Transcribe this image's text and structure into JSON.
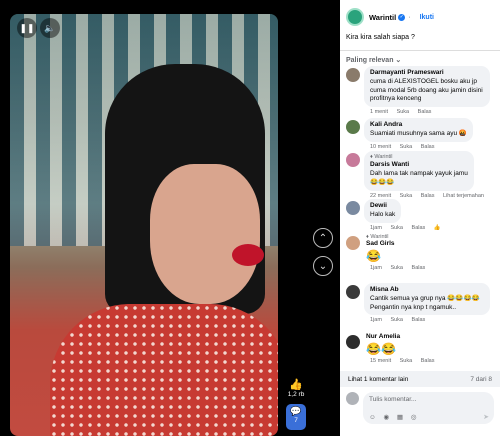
{
  "video": {
    "likes": "1,2 rb",
    "comments": "7"
  },
  "post": {
    "page_name": "Warintil",
    "follow_label": "Ikuti",
    "separator": "·",
    "caption": "Kira kira salah siapa ?",
    "sort_label": "Paling relevan ⌄",
    "avatar_color": "#2aa37c"
  },
  "comments": [
    {
      "author": "Darmayanti Prameswari",
      "badge": "",
      "text": "cuma di ALEXISTOGEL bosku aku jp cuma modal 5rb doang aku jamin disini profitnya kenceng",
      "time": "1 menit",
      "actions": [
        "Suka",
        "Balas"
      ],
      "avatar_color": "#8a7b6b"
    },
    {
      "author": "Kali Andra",
      "badge": "",
      "text": "Suamiati musuhnya sama ayu 🤬",
      "time": "10 menit",
      "actions": [
        "Suka",
        "Balas"
      ],
      "avatar_color": "#5a7a4a"
    },
    {
      "author": "Darsis Wanti",
      "badge": "Warintil",
      "text": "Dah lama tak nampak yayuk jamu",
      "emoji": "😂😂😂",
      "time": "22 menit",
      "actions": [
        "Suka",
        "Balas",
        "Lihat terjemahan"
      ],
      "avatar_color": "#c77a9a"
    },
    {
      "author": "Dewii",
      "badge": "",
      "text": "Halo kak",
      "time": "1jam",
      "actions": [
        "Suka",
        "Balas"
      ],
      "reaction": "👍",
      "avatar_color": "#7a8aa0"
    },
    {
      "author": "Sad Girls",
      "badge": "Warintil",
      "text": "",
      "big_emoji": "😂",
      "time": "1jam",
      "actions": [
        "Suka",
        "Balas"
      ],
      "avatar_color": "#d0a080"
    },
    {
      "author": "Misna Ab",
      "badge": "",
      "text": "Cantik semua ya grup nya 😂😂😂😂",
      "text2": "Pengantin nya knp t ngamuk..",
      "time": "1jam",
      "actions": [
        "Suka",
        "Balas"
      ],
      "avatar_color": "#3a3a3a"
    },
    {
      "author": "Nur Amelia",
      "badge": "",
      "text": "",
      "big_emoji": "😂😂",
      "time": "15 menit",
      "actions": [
        "Suka",
        "Balas"
      ],
      "avatar_color": "#2d2d2d"
    }
  ],
  "more_comments": {
    "label": "Lihat 1 komentar lain",
    "count": "7 dari 8"
  },
  "composer": {
    "placeholder": "Tulis komentar...",
    "tools": "☺ ◉ ▦ ◎",
    "send": "➤"
  },
  "colors": {
    "accent": "#1877f2",
    "bubble": "#f0f2f5"
  }
}
